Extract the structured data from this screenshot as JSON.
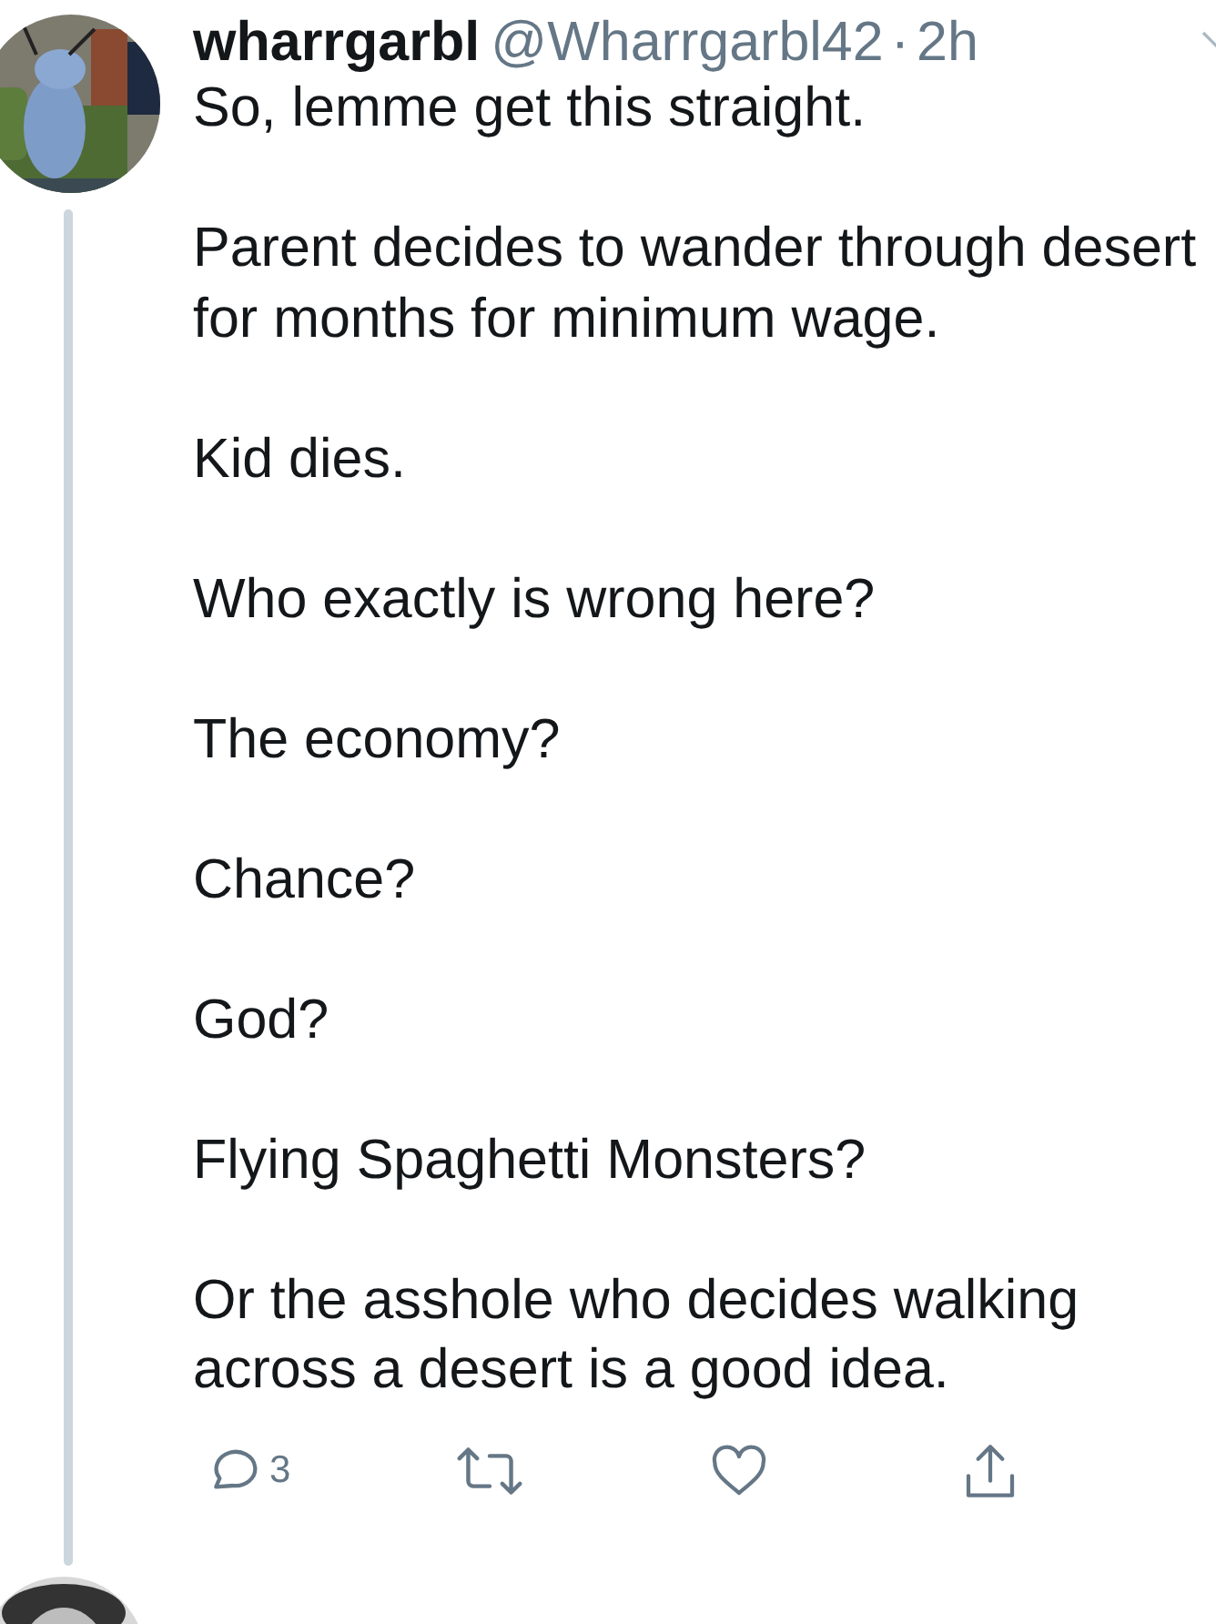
{
  "tweet": {
    "name": "wharrgarbl",
    "handle": "@Wharrgarbl42",
    "separator": "·",
    "time": "2h",
    "paragraphs": [
      "So, lemme get this straight.",
      "Parent decides to wander through desert for months for minimum wage.",
      "Kid dies.",
      "Who exactly is wrong here?",
      "The economy?",
      "Chance?",
      "God?",
      "Flying Spaghetti Monsters?",
      "Or the asshole who decides walking across a desert is a good idea."
    ],
    "actions": [
      {
        "kind": "reply",
        "count": "3"
      },
      {
        "kind": "retweet"
      },
      {
        "kind": "like"
      },
      {
        "kind": "share"
      }
    ]
  }
}
